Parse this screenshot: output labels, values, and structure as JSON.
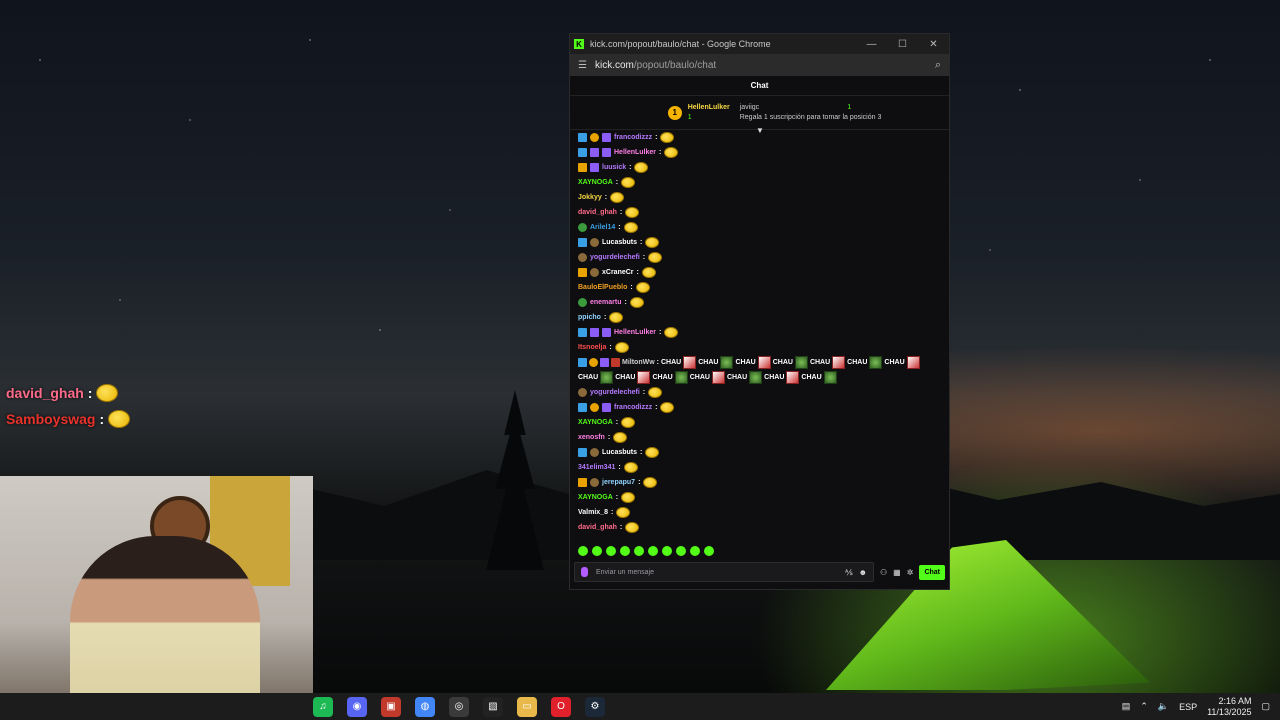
{
  "window": {
    "title": "kick.com/popout/baulo/chat - Google Chrome",
    "url_domain": "kick.com",
    "url_path": "/popout/baulo/chat",
    "controls": [
      "—",
      "☐",
      "✕"
    ]
  },
  "chat": {
    "header": "Chat",
    "pinned": {
      "rank": "1",
      "user": "HellenLulker",
      "sub_count": "1",
      "recipient": "javiigc",
      "right_count": "1",
      "message": "Regala 1 suscripción para tomar la posición 3"
    },
    "messages": [
      {
        "user": "francodizzz",
        "color": "#b57aff",
        "badges": [
          "blue",
          "gold",
          "purple"
        ]
      },
      {
        "user": "HellenLulker",
        "color": "#ff7fe6",
        "badges": [
          "blue",
          "purple",
          "purple"
        ]
      },
      {
        "user": "luusick",
        "color": "#b57aff",
        "badges": [
          "orange",
          "purple"
        ]
      },
      {
        "user": "XAYNOGA",
        "color": "#53fc18",
        "badges": []
      },
      {
        "user": "Jokkyy",
        "color": "#f5d742",
        "badges": []
      },
      {
        "user": "david_ghah",
        "color": "#ff6b8a",
        "badges": []
      },
      {
        "user": "Arilel14",
        "color": "#3aa0e6",
        "badges": [
          "green"
        ]
      },
      {
        "user": "Lucasbuts",
        "color": "#ffffff",
        "badges": [
          "blue",
          "brown"
        ]
      },
      {
        "user": "yogurdelechefi",
        "color": "#b57aff",
        "badges": [
          "brown"
        ]
      },
      {
        "user": "xCraneCr",
        "color": "#ffffff",
        "badges": [
          "orange",
          "brown"
        ]
      },
      {
        "user": "BauloElPueblo",
        "color": "#f0a020",
        "badges": []
      },
      {
        "user": "enemartu",
        "color": "#ff7fe6",
        "badges": [
          "green"
        ]
      },
      {
        "user": "ppicho",
        "color": "#8fd3ff",
        "badges": []
      },
      {
        "user": "HellenLulker",
        "color": "#ff7fe6",
        "badges": [
          "blue",
          "purple",
          "purple"
        ]
      },
      {
        "user": "Itsnoelja",
        "color": "#ff4d4d",
        "badges": []
      }
    ],
    "chau_message": {
      "user": "MiltonWw",
      "word": "CHAU",
      "count": 14
    },
    "messages_after": [
      {
        "user": "yogurdelechefi",
        "color": "#b57aff",
        "badges": [
          "brown"
        ]
      },
      {
        "user": "francodizzz",
        "color": "#b57aff",
        "badges": [
          "blue",
          "gold",
          "purple"
        ]
      },
      {
        "user": "XAYNOGA",
        "color": "#53fc18",
        "badges": []
      },
      {
        "user": "xenosfn",
        "color": "#ff7fe6",
        "badges": []
      },
      {
        "user": "Lucasbuts",
        "color": "#ffffff",
        "badges": [
          "blue",
          "brown"
        ]
      },
      {
        "user": "341elim341",
        "color": "#b57aff",
        "badges": []
      },
      {
        "user": "jerepapu7",
        "color": "#8fd3ff",
        "badges": [
          "orange",
          "brown"
        ]
      },
      {
        "user": "XAYNOGA",
        "color": "#53fc18",
        "badges": []
      },
      {
        "user": "Valmix_8",
        "color": "#ffffff",
        "badges": []
      },
      {
        "user": "david_ghah",
        "color": "#ff6b8a",
        "badges": []
      }
    ],
    "input_placeholder": "Enviar un mensaje",
    "send_label": "Chat"
  },
  "overlay": {
    "lines": [
      {
        "user": "david_ghah",
        "color": "#ff6b8a"
      },
      {
        "user": "Samboyswag",
        "color": "#e8332c"
      }
    ],
    "separator": ":"
  },
  "taskbar": {
    "apps": [
      {
        "name": "spotify-icon",
        "color": "#1db954",
        "glyph": "♫"
      },
      {
        "name": "discord-icon",
        "color": "#5865f2",
        "glyph": "◉"
      },
      {
        "name": "video-app-icon",
        "color": "#c0392b",
        "glyph": "▣"
      },
      {
        "name": "chrome-icon",
        "color": "#4285f4",
        "glyph": "◍"
      },
      {
        "name": "obs-icon",
        "color": "#3a3a3a",
        "glyph": "◎"
      },
      {
        "name": "capcut-icon",
        "color": "#222222",
        "glyph": "▧"
      },
      {
        "name": "file-explorer-icon",
        "color": "#e8b84a",
        "glyph": "▭"
      },
      {
        "name": "opera-icon",
        "color": "#e0202a",
        "glyph": "O"
      },
      {
        "name": "steam-icon",
        "color": "#1b2838",
        "glyph": "⚙"
      }
    ],
    "language": "ESP",
    "time": "2:16 AM",
    "date": "11/13/2025"
  }
}
